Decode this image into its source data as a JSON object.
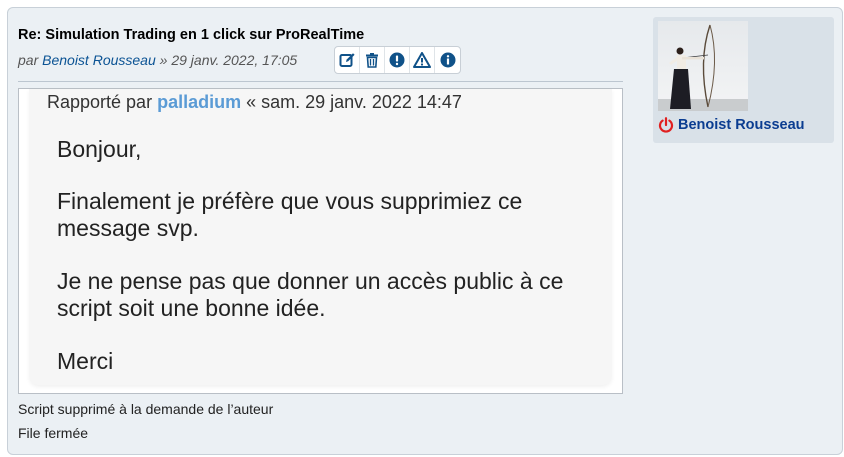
{
  "post": {
    "title": "Re: Simulation Trading en 1 click sur ProRealTime",
    "by_prefix": "par ",
    "author": "Benoist Rousseau",
    "date_sep": " » ",
    "date": "29 janv. 2022, 17:05",
    "actions": [
      {
        "name": "edit-icon",
        "color": "#105289"
      },
      {
        "name": "delete-icon",
        "color": "#105289"
      },
      {
        "name": "warning-icon",
        "color": "#105289"
      },
      {
        "name": "report-icon",
        "color": "#105289"
      },
      {
        "name": "info-icon",
        "color": "#105289"
      }
    ]
  },
  "report": {
    "prefix": "Rapporté par ",
    "reporter": "palladium",
    "date": " « sam. 29 janv. 2022 14:47",
    "lines": [
      "Bonjour,",
      "Finalement je préfère que vous supprimiez ce",
      "message svp.",
      "Je ne pense pas que donner un accès public à ce",
      "script soit une bonne idée.",
      "Merci"
    ]
  },
  "notes": {
    "deleted": "Script supprimé à la demande de l’auteur",
    "locked": "File fermée"
  },
  "profile": {
    "name": "Benoist Rousseau",
    "status_icon": "power-icon",
    "status_color": "#e02020"
  }
}
